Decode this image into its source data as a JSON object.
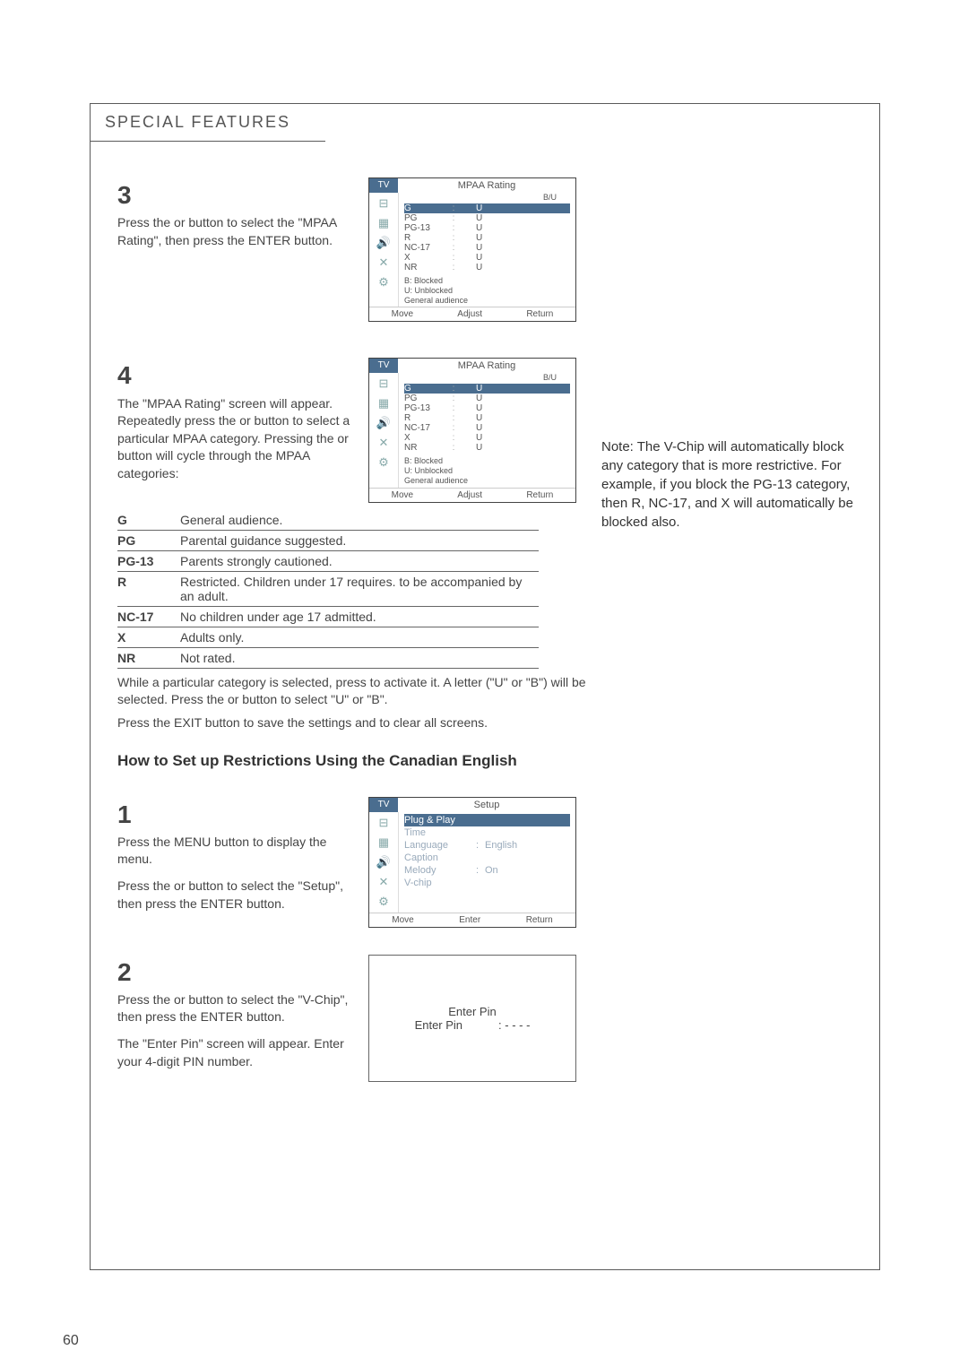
{
  "header": "SPECIAL FEATURES",
  "page_number": "60",
  "note": "Note: The V-Chip will automatically block any category that is  more restrictive.  For example, if you block the  PG-13  category, then  R,   NC-17,  and  X  will automatically be blocked also.",
  "step3": {
    "num": "3",
    "text": "Press the       or       button to select  the \"MPAA Rating\", then press the ENTER button."
  },
  "step4": {
    "num": "4",
    "text": "The \"MPAA Rating\" screen will appear. Repeatedly press the       or       button to select a particular MPAA category. Pressing the       or       button will cycle through the MPAA categories:"
  },
  "ratings": [
    {
      "label": "G",
      "desc": "General audience."
    },
    {
      "label": "PG",
      "desc": "Parental guidance suggested."
    },
    {
      "label": "PG-13",
      "desc": "Parents strongly cautioned."
    },
    {
      "label": "R",
      "desc": "Restricted. Children under 17 requires. to be accompanied by an adult."
    },
    {
      "label": "NC-17",
      "desc": "No children under age 17 admitted."
    },
    {
      "label": "X",
      "desc": "Adults only."
    },
    {
      "label": "NR",
      "desc": "Not rated."
    }
  ],
  "after_table": "While a particular category is selected, press        to activate it. A letter (\"U\" or \"B\") will be selected. Press the        or       button to select \"U\" or \"B\".",
  "exit_line": "Press the EXIT button to save the settings and to clear all screens.",
  "subheading": "How to Set up Restrictions Using the Canadian English",
  "step1": {
    "num": "1",
    "text1": "Press the MENU button to display the menu.",
    "text2": "Press the       or       button to select  the \"Setup\", then press the ENTER button."
  },
  "step2": {
    "num": "2",
    "text1": "Press the       or       button to select  the \"V-Chip\", then press the ENTER button.",
    "text2": "The \"Enter Pin\" screen will appear. Enter your 4-digit PIN number."
  },
  "osd_mpaa": {
    "tab": "TV",
    "title": "MPAA Rating",
    "hdr": "B/U",
    "rows": [
      {
        "c1": "G",
        "c3": "U",
        "hl": true
      },
      {
        "c1": "PG",
        "c3": "U"
      },
      {
        "c1": "PG-13",
        "c3": "U"
      },
      {
        "c1": "R",
        "c3": "U"
      },
      {
        "c1": "NC-17",
        "c3": "U"
      },
      {
        "c1": "X",
        "c3": "U"
      },
      {
        "c1": "NR",
        "c3": "U"
      }
    ],
    "legend": [
      "B:  Blocked",
      "U:  Unblocked",
      "General audience"
    ],
    "foot": [
      "Move",
      "Adjust",
      "Return"
    ]
  },
  "osd_setup": {
    "tab": "TV",
    "title": "Setup",
    "rows": [
      {
        "s1": "Plug & Play",
        "sel": true
      },
      {
        "s1": "Time"
      },
      {
        "s1": "Language",
        "s2": ":",
        "s3": "English"
      },
      {
        "s1": "Caption"
      },
      {
        "s1": "Melody",
        "s2": ":",
        "s3": "On"
      },
      {
        "s1": "V-chip"
      }
    ],
    "foot": [
      "Move",
      "Enter",
      "Return"
    ]
  },
  "pin": {
    "line1": "Enter Pin",
    "line2a": "Enter Pin",
    "line2b": ": - - - -"
  }
}
